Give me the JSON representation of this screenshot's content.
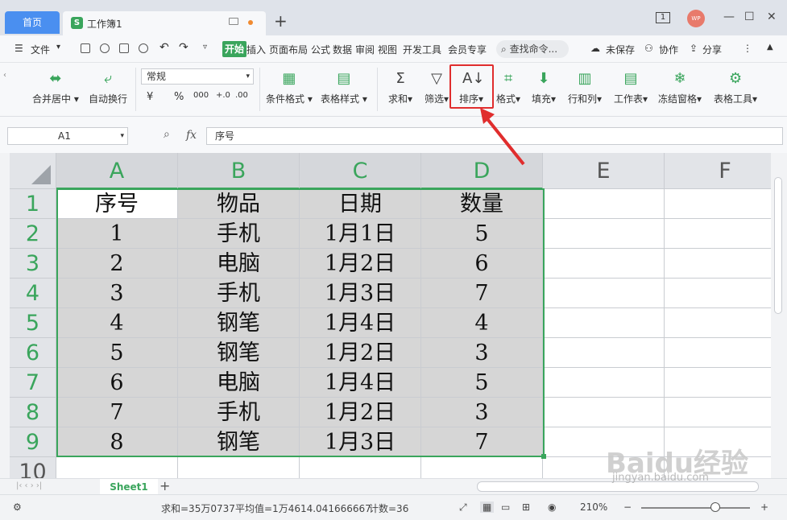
{
  "tabs": {
    "home": "首页",
    "workbook": "工作簿1",
    "add": "+"
  },
  "titlebar": {
    "window_count": "1",
    "avatar": "WP",
    "min": "—",
    "max": "☐",
    "close": "✕"
  },
  "menu": {
    "file": "文件",
    "items": [
      "开始",
      "插入",
      "页面布局",
      "公式",
      "数据",
      "审阅",
      "视图",
      "开发工具",
      "会员专享"
    ],
    "search": "查找命令...",
    "unsaved": "未保存",
    "collab": "协作",
    "share": "分享"
  },
  "ribbon": {
    "merge": "合并居中",
    "wrap": "自动换行",
    "number_format": "常规",
    "symbols": [
      "¥",
      "%",
      "000",
      "+.0",
      ".00"
    ],
    "cond_format": "条件格式",
    "table_style": "表格样式",
    "sum": "求和",
    "filter": "筛选",
    "sort": "排序",
    "format": "格式",
    "fill": "填充",
    "rowcol": "行和列",
    "sheet": "工作表",
    "freeze": "冻结窗格",
    "tools": "表格工具"
  },
  "formula_bar": {
    "cell_ref": "A1",
    "fx": "fx",
    "value": "序号"
  },
  "columns": [
    "A",
    "B",
    "C",
    "D",
    "E",
    "F"
  ],
  "rows": [
    "1",
    "2",
    "3",
    "4",
    "5",
    "6",
    "7",
    "8",
    "9",
    "10"
  ],
  "table": [
    [
      "序号",
      "物品",
      "日期",
      "数量"
    ],
    [
      "1",
      "手机",
      "1月1日",
      "5"
    ],
    [
      "2",
      "电脑",
      "1月2日",
      "6"
    ],
    [
      "3",
      "手机",
      "1月3日",
      "7"
    ],
    [
      "4",
      "钢笔",
      "1月4日",
      "4"
    ],
    [
      "5",
      "钢笔",
      "1月2日",
      "3"
    ],
    [
      "6",
      "电脑",
      "1月4日",
      "5"
    ],
    [
      "7",
      "手机",
      "1月2日",
      "3"
    ],
    [
      "8",
      "钢笔",
      "1月3日",
      "7"
    ]
  ],
  "sheet": {
    "tab": "Sheet1",
    "add": "+"
  },
  "status": {
    "sum": "求和=35万0737",
    "avg": "平均值=1万4614.041666667",
    "count": "计数=36",
    "zoom": "210%"
  },
  "watermark": {
    "main": "Baidu经验",
    "sub": "jingyan.baidu.com"
  },
  "colors": {
    "accent": "#3aa55c",
    "highlight": "#e02d2d",
    "tab_blue": "#4a8ff0"
  }
}
